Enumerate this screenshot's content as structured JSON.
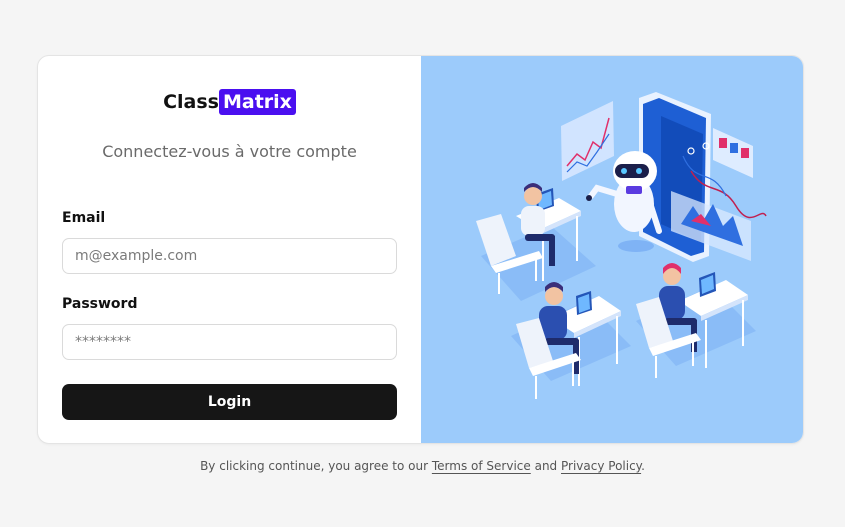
{
  "brand": {
    "name_part1": "Class",
    "name_part2": "Matrix",
    "accent_color": "#4a0ff0"
  },
  "subtitle": "Connectez-vous à votre compte",
  "form": {
    "email_label": "Email",
    "email_placeholder": "m@example.com",
    "password_label": "Password",
    "password_placeholder": "********",
    "login_label": "Login"
  },
  "footer": {
    "prefix": "By clicking continue, you agree to our",
    "terms_label": "Terms of Service",
    "and": "and",
    "privacy_label": "Privacy Policy",
    "suffix": "."
  },
  "illustration": {
    "icon": "classroom-ai-robot-illustration",
    "background_color": "#9ccbfb"
  },
  "colors": {
    "button_bg": "#161616",
    "page_bg": "#f5f5f5"
  }
}
